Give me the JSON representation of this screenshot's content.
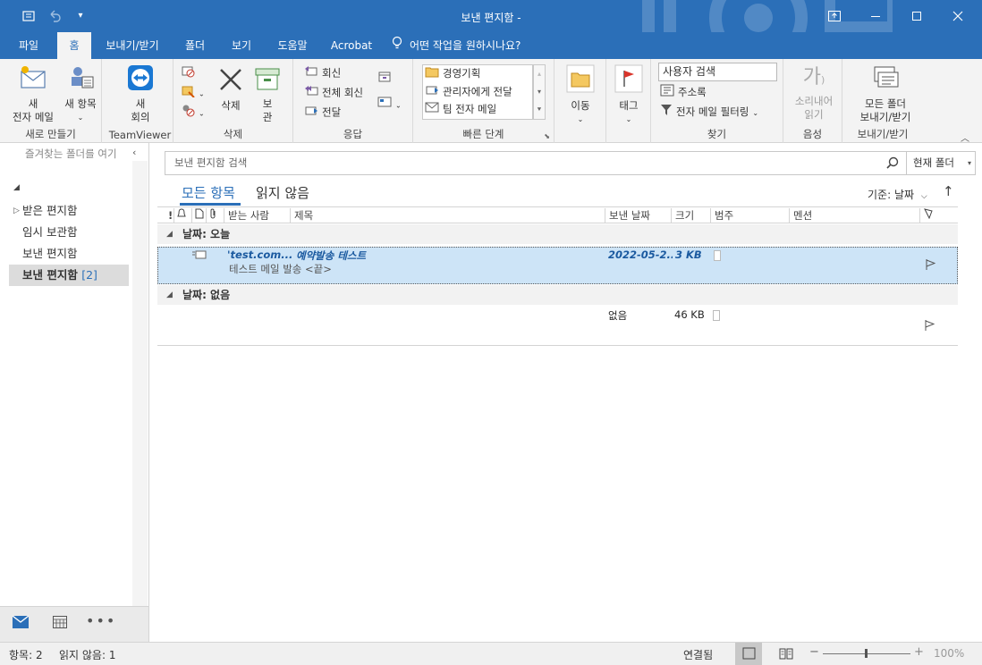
{
  "window": {
    "title": "보낸 편지함 -",
    "qat_customize": "▾"
  },
  "tabs": [
    {
      "label": "파일"
    },
    {
      "label": "홈"
    },
    {
      "label": "보내기/받기"
    },
    {
      "label": "폴더"
    },
    {
      "label": "보기"
    },
    {
      "label": "도움말"
    },
    {
      "label": "Acrobat"
    },
    {
      "label": "어떤 작업을 원하시나요?"
    }
  ],
  "ribbon": {
    "new_group": {
      "label": "새로 만들기",
      "new_email": [
        "새",
        "전자 메일"
      ],
      "new_items": [
        "새 항목"
      ]
    },
    "teamviewer_group": {
      "label": "TeamViewer",
      "meeting": [
        "새",
        "회의"
      ]
    },
    "delete_group": {
      "label": "삭제",
      "delete": "삭제",
      "archive": [
        "보",
        "관"
      ]
    },
    "respond_group": {
      "label": "응답",
      "reply": "회신",
      "reply_all": "전체 회신",
      "forward": "전달"
    },
    "quicksteps_group": {
      "label": "빠른 단계",
      "items": [
        "경영기획",
        "관리자에게 전달",
        "팀 전자 메일"
      ]
    },
    "move_group": {
      "label": "이동"
    },
    "tags_group": {
      "label": "태그"
    },
    "find_group": {
      "label": "찾기",
      "people_search": "사용자 검색",
      "address_book": "주소록",
      "filter_email": "전자 메일 필터링"
    },
    "speech_group": {
      "label": "음성",
      "read_aloud": [
        "소리내어",
        "읽기"
      ]
    },
    "sendreceive_group": {
      "label": "보내기/받기",
      "send_receive_all": [
        "모든 폴더",
        "보내기/받기"
      ]
    }
  },
  "folder_pane": {
    "favorites_hint": "즐겨찾는 폴더를 여기",
    "folders": [
      {
        "name": "받은 편지함",
        "count": ""
      },
      {
        "name": "임시 보관함",
        "count": ""
      },
      {
        "name": "보낸 편지함",
        "count": ""
      },
      {
        "name": "보낸 편지함",
        "count": "[2]"
      }
    ]
  },
  "search": {
    "placeholder": "보낸 편지함 검색",
    "scope": "현재 폴더"
  },
  "filters": {
    "all": "모든 항목",
    "unread": "읽지 않음",
    "sort_by": "기준: 날짜"
  },
  "columns": {
    "importance": "!",
    "to": "받는 사람",
    "subject": "제목",
    "sent": "보낸 날짜",
    "size": "크기",
    "category": "범주",
    "mention": "멘션"
  },
  "groups": [
    {
      "label": "날짜: 오늘",
      "messages": [
        {
          "to": "'test.com...",
          "subject": "예약발송 테스트",
          "preview": "테스트 메일 발송  <끝>",
          "sent": "2022-05-2...",
          "size": "3 KB"
        }
      ]
    },
    {
      "label": "날짜: 없음",
      "messages": [
        {
          "to": "",
          "subject": "",
          "preview": "",
          "sent": "없음",
          "size": "46 KB"
        }
      ]
    }
  ],
  "status": {
    "items": "항목: 2",
    "unread": "읽지 않음: 1",
    "connection": "연결됨",
    "zoom": "100%"
  },
  "colors": {
    "accent": "#2b6fb8",
    "selected_row": "#cde4f7"
  }
}
